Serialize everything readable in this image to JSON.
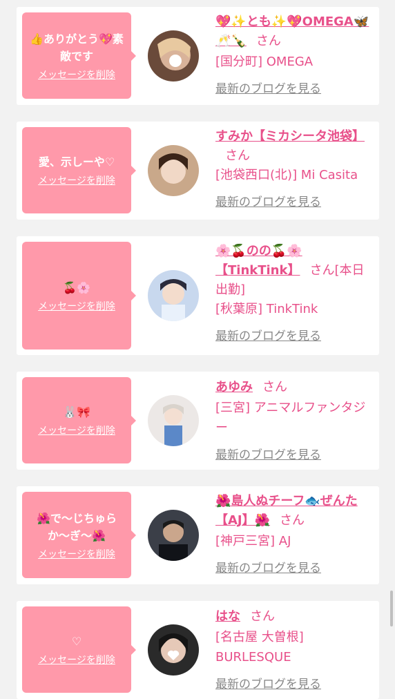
{
  "cards": [
    {
      "message": "👍ありがとう💖素敵です",
      "delete_label": "メッセージを削除",
      "name": "💖✨とも✨💖OMEGA🦋🥂🍾",
      "honorific": "さん",
      "extra": "",
      "shop": "[国分町] OMEGA",
      "blog_label": "最新のブログを見る"
    },
    {
      "message": "愛、示しーや♡",
      "delete_label": "メッセージを削除",
      "name": "すみか【ミカシータ池袋】",
      "honorific": "さん",
      "extra": "",
      "shop": "[池袋西口(北)] Mi Casita",
      "blog_label": "最新のブログを見る"
    },
    {
      "message": "🍒🌸",
      "delete_label": "メッセージを削除",
      "name": "🌸🍒のの🍒🌸【TinkTink】",
      "honorific": "さん",
      "extra": "[本日出勤]",
      "shop": "[秋葉原] TinkTink",
      "blog_label": "最新のブログを見る"
    },
    {
      "message": "🐰🎀",
      "delete_label": "メッセージを削除",
      "name": "あゆみ",
      "honorific": "さん",
      "extra": "",
      "shop": "[三宮] アニマルファンタジー",
      "blog_label": "最新のブログを見る"
    },
    {
      "message": "🌺で〜じちゅらか〜ぎ〜🌺",
      "delete_label": "メッセージを削除",
      "name": "🌺島人ぬチーフ🐟ぜんた【AJ】🌺",
      "honorific": "さん",
      "extra": "",
      "shop": "[神戸三宮] AJ",
      "blog_label": "最新のブログを見る"
    },
    {
      "message": "♡",
      "delete_label": "メッセージを削除",
      "name": "はな",
      "honorific": "さん",
      "extra": "",
      "shop": "[名古屋 大曽根] BURLESQUE",
      "blog_label": "最新のブログを見る"
    }
  ],
  "colors": {
    "bubble": "#ff99aa",
    "name": "#e8508a",
    "blog_link": "#888888",
    "background": "#f2f2f2"
  }
}
